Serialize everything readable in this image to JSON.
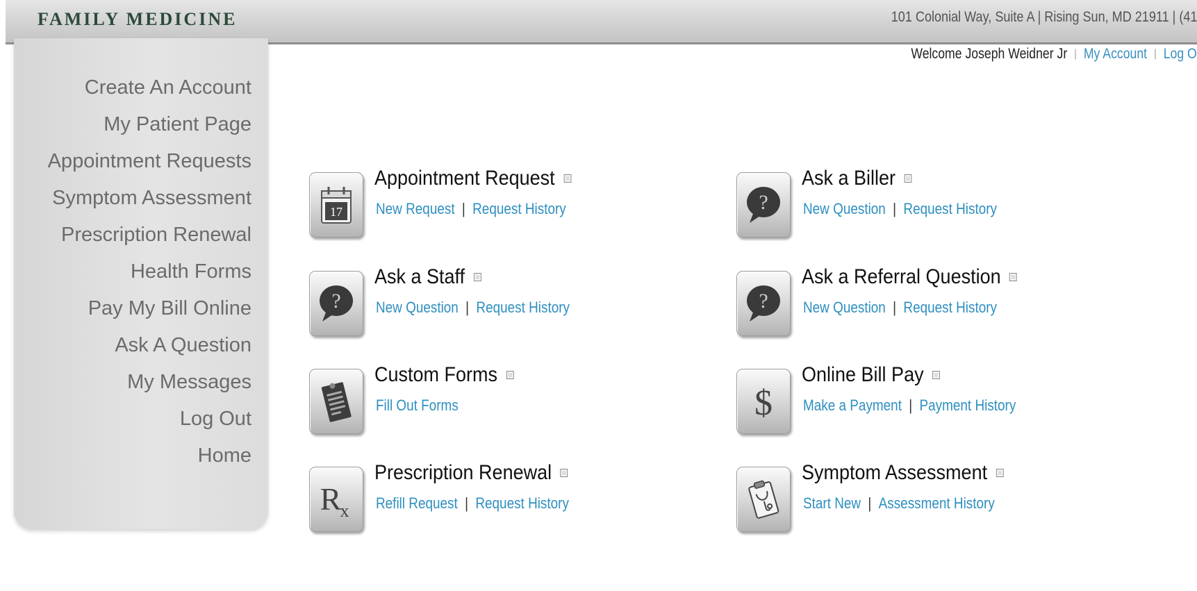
{
  "header": {
    "brand": "FAMILY MEDICINE",
    "address": "101 Colonial Way, Suite A | Rising Sun, MD 21911 | (41"
  },
  "welcome": {
    "text": "Welcome Joseph Weidner Jr",
    "my_account": "My Account",
    "log_out": "Log O"
  },
  "sidebar": {
    "items": [
      {
        "label": "Create An Account"
      },
      {
        "label": "My Patient Page"
      },
      {
        "label": "Appointment Requests"
      },
      {
        "label": "Symptom Assessment"
      },
      {
        "label": "Prescription Renewal"
      },
      {
        "label": "Health Forms"
      },
      {
        "label": "Pay My Bill Online"
      },
      {
        "label": "Ask A Question"
      },
      {
        "label": "My Messages"
      },
      {
        "label": "Log Out"
      },
      {
        "label": "Home"
      }
    ]
  },
  "tiles": {
    "appointment": {
      "title": "Appointment Request",
      "icon": "calendar-icon",
      "icon_text": "17",
      "link1": "New Request",
      "link2": "Request History"
    },
    "biller": {
      "title": "Ask a Biller",
      "icon": "speech-bubble-question-icon",
      "link1": "New Question",
      "link2": "Request History"
    },
    "staff": {
      "title": "Ask a Staff",
      "icon": "speech-bubble-question-icon",
      "link1": "New Question",
      "link2": "Request History"
    },
    "referral": {
      "title": "Ask a Referral Question",
      "icon": "speech-bubble-question-icon",
      "link1": "New Question",
      "link2": "Request History"
    },
    "forms": {
      "title": "Custom Forms",
      "icon": "clipboard-form-icon",
      "link1": "Fill Out Forms"
    },
    "billpay": {
      "title": "Online Bill Pay",
      "icon": "dollar-icon",
      "icon_text": "$",
      "link1": "Make a Payment",
      "link2": "Payment History"
    },
    "prescription": {
      "title": "Prescription Renewal",
      "icon": "rx-icon",
      "icon_text": "Rx",
      "link1": "Refill Request",
      "link2": "Request History"
    },
    "symptom": {
      "title": "Symptom Assessment",
      "icon": "clipboard-stethoscope-icon",
      "link1": "Start New",
      "link2": "Assessment History"
    }
  },
  "colors": {
    "brand_text": "#2c4a3a",
    "link": "#2e8fc0",
    "sidebar_text": "#6b6b6b",
    "header_bg": "#d2d2d2"
  }
}
